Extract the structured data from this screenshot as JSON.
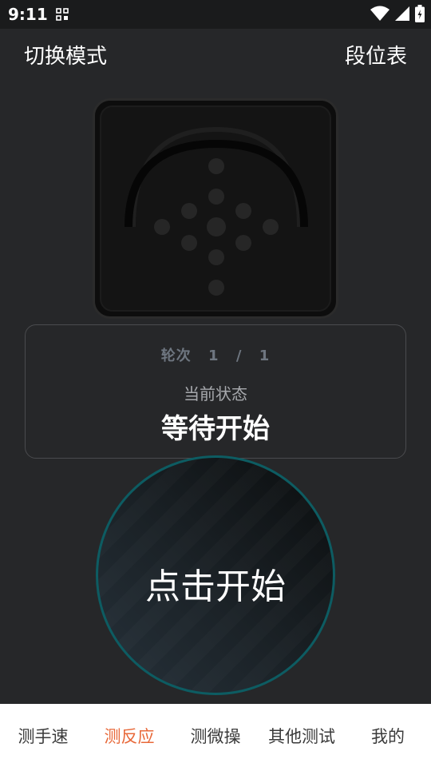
{
  "status_bar": {
    "time": "9:11",
    "icons": [
      "grid-icon",
      "wifi-icon",
      "signal-icon",
      "battery-icon"
    ]
  },
  "header": {
    "mode_button": "切换模式",
    "table_button": "段位表"
  },
  "round": {
    "label": "轮次",
    "current": "1",
    "separator": "/",
    "total": "1"
  },
  "state": {
    "label": "当前状态",
    "value": "等待开始"
  },
  "start_button": "点击开始",
  "nav": {
    "items": [
      {
        "label": "测手速",
        "active": false
      },
      {
        "label": "测反应",
        "active": true
      },
      {
        "label": "测微操",
        "active": false
      },
      {
        "label": "其他测试",
        "active": false
      },
      {
        "label": "我的",
        "active": false
      }
    ]
  },
  "colors": {
    "accent": "#e8693a",
    "ring": "#0d5c62",
    "background": "#262729"
  }
}
